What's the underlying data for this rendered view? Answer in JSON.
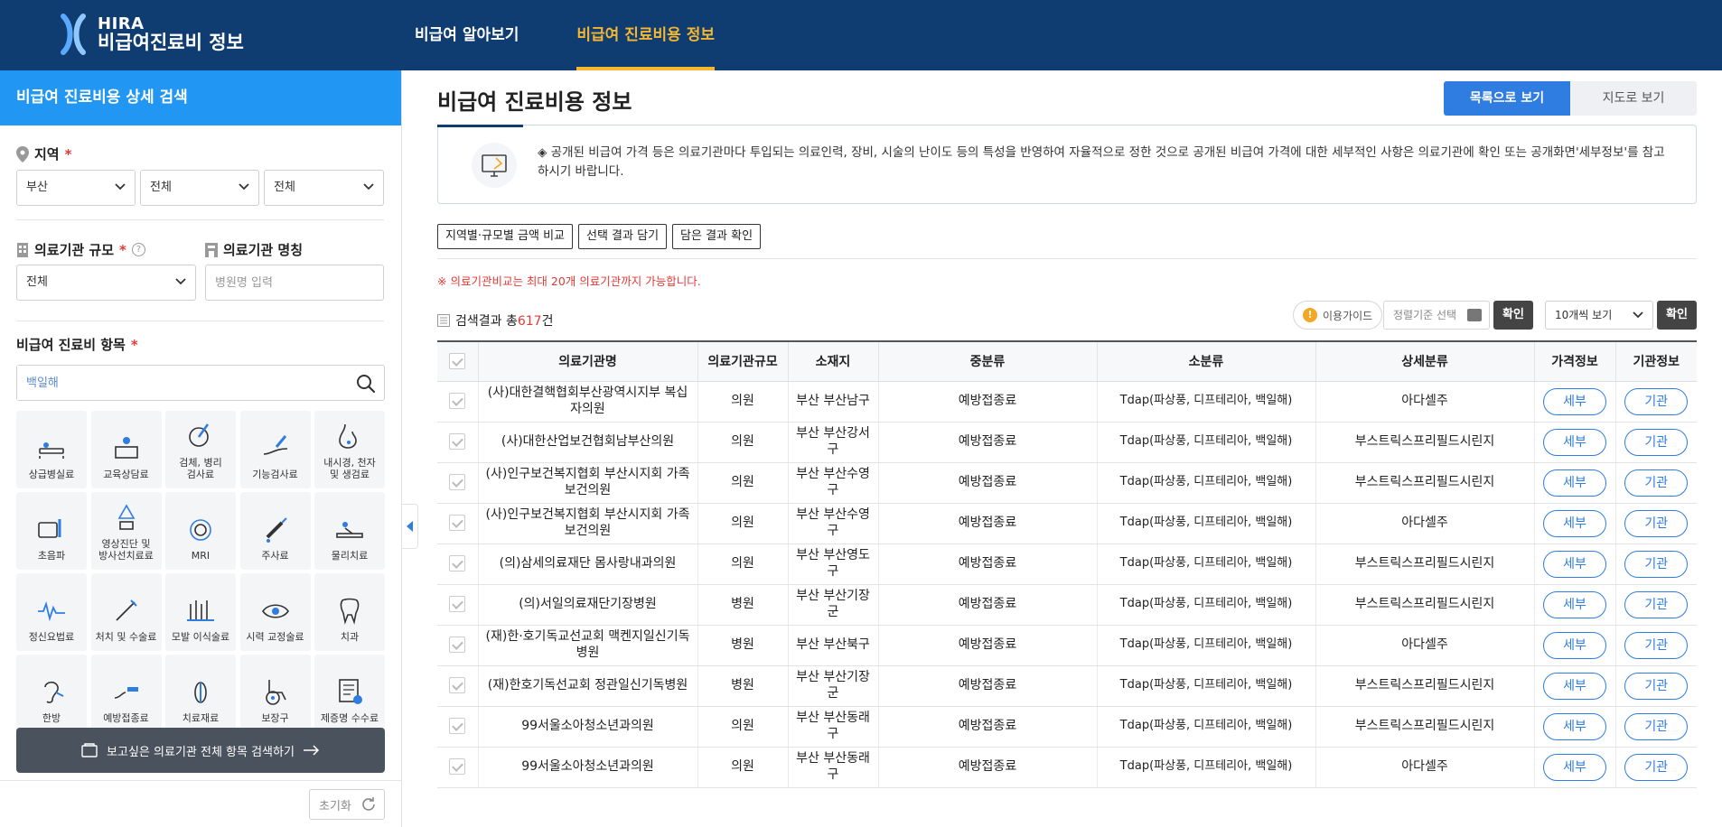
{
  "header": {
    "logo_line1": "HIRA",
    "logo_line2": "비급여진료비 정보",
    "nav": [
      "비급여 알아보기",
      "비급여 진료비용 정보"
    ]
  },
  "sidebar": {
    "title": "비급여 진료비용 상세 검색",
    "region": {
      "label": "지역",
      "required": "*",
      "select1": "부산",
      "select2": "전체",
      "select3": "전체"
    },
    "size": {
      "label": "의료기관 규모",
      "required": "*",
      "help": "?",
      "value": "전체"
    },
    "name": {
      "label": "의료기관 명칭",
      "placeholder": "병원명 입력"
    },
    "items": {
      "label": "비급여 진료비 항목",
      "required": "*",
      "search_placeholder": "백일해",
      "tiles": [
        "상급병실료",
        "교육상담료",
        "검체, 병리\n검사료",
        "기능검사료",
        "내시경, 천자\n및 생검료",
        "초음파",
        "영상진단 및\n방사선치료료",
        "MRI",
        "주사료",
        "물리치료",
        "정신요법료",
        "처치 및 수술료",
        "모발 이식술료",
        "시력 교정술료",
        "치과",
        "한방",
        "예방접종료",
        "치료재료",
        "보장구",
        "제증명 수수료"
      ]
    },
    "search_all_button": "보고싶은 의료기관 전체 항목 검색하기",
    "reset_button": "초기화"
  },
  "main": {
    "title": "비급여 진료비용 정보",
    "view_list": "목록으로 보기",
    "view_map": "지도로 보기",
    "notice": "◈ 공개된 비급여 가격 등은 의료기관마다 투입되는 의료인력, 장비, 시술의 난이도 등의 특성을 반영하여 자율적으로 정한 것으로 공개된 비급여 가격에 대한 세부적인 사항은 의료기관에 확인 또는 공개화면'세부정보'를 참고하시기 바랍니다.",
    "actions": [
      "지역별·규모별 금액 비교",
      "선택 결과 담기",
      "담은 결과 확인"
    ],
    "warning": "※ 의료기관비교는 최대 20개 의료기관까지 가능합니다.",
    "result_prefix": "검색결과 총",
    "result_count": "617",
    "result_suffix": "건",
    "guide": "이용가이드",
    "guide_dot": "!",
    "sort_placeholder": "정렬기준 선택",
    "confirm": "확인",
    "per_page": "10개씩 보기",
    "columns": [
      "의료기관명",
      "의료기관규모",
      "소재지",
      "중분류",
      "소분류",
      "상세분류",
      "가격정보",
      "기관정보"
    ],
    "detail_btn": "세부",
    "inst_btn": "기관",
    "rows": [
      {
        "name": "(사)대한결핵협회부산광역시지부 복십자의원",
        "size": "의원",
        "loc": "부산 부산남구",
        "mid": "예방접종료",
        "small": "Tdap(파상풍, 디프테리아, 백일해)",
        "detail": "아다셀주"
      },
      {
        "name": "(사)대한산업보건협회남부산의원",
        "size": "의원",
        "loc": "부산 부산강서구",
        "mid": "예방접종료",
        "small": "Tdap(파상풍, 디프테리아, 백일해)",
        "detail": "부스트릭스프리필드시린지"
      },
      {
        "name": "(사)인구보건복지협회 부산시지회 가족보건의원",
        "size": "의원",
        "loc": "부산 부산수영구",
        "mid": "예방접종료",
        "small": "Tdap(파상풍, 디프테리아, 백일해)",
        "detail": "부스트릭스프리필드시린지"
      },
      {
        "name": "(사)인구보건복지협회 부산시지회 가족보건의원",
        "size": "의원",
        "loc": "부산 부산수영구",
        "mid": "예방접종료",
        "small": "Tdap(파상풍, 디프테리아, 백일해)",
        "detail": "아다셀주"
      },
      {
        "name": "(의)삼세의료재단 몸사랑내과의원",
        "size": "의원",
        "loc": "부산 부산영도구",
        "mid": "예방접종료",
        "small": "Tdap(파상풍, 디프테리아, 백일해)",
        "detail": "부스트릭스프리필드시린지"
      },
      {
        "name": "(의)서일의료재단기장병원",
        "size": "병원",
        "loc": "부산 부산기장군",
        "mid": "예방접종료",
        "small": "Tdap(파상풍, 디프테리아, 백일해)",
        "detail": "부스트릭스프리필드시린지"
      },
      {
        "name": "(재)한·호기독교선교회 맥켄지일신기독병원",
        "size": "병원",
        "loc": "부산 부산북구",
        "mid": "예방접종료",
        "small": "Tdap(파상풍, 디프테리아, 백일해)",
        "detail": "아다셀주"
      },
      {
        "name": "(재)한호기독선교회 정관일신기독병원",
        "size": "병원",
        "loc": "부산 부산기장군",
        "mid": "예방접종료",
        "small": "Tdap(파상풍, 디프테리아, 백일해)",
        "detail": "부스트릭스프리필드시린지"
      },
      {
        "name": "99서울소아청소년과의원",
        "size": "의원",
        "loc": "부산 부산동래구",
        "mid": "예방접종료",
        "small": "Tdap(파상풍, 디프테리아, 백일해)",
        "detail": "부스트릭스프리필드시린지"
      },
      {
        "name": "99서울소아청소년과의원",
        "size": "의원",
        "loc": "부산 부산동래구",
        "mid": "예방접종료",
        "small": "Tdap(파상풍, 디프테리아, 백일해)",
        "detail": "아다셀주"
      }
    ]
  },
  "colors": {
    "header_bg": "#0f3d72",
    "accent": "#f5b630",
    "sidebar_head": "#2196f3",
    "primary": "#2f7de1",
    "danger": "#e53935"
  },
  "icons": [
    "location-pin-icon",
    "building-icon",
    "help-icon",
    "search-icon",
    "chevron-down-icon",
    "refresh-icon",
    "document-icon",
    "arrow-right-icon",
    "collapse-arrow-icon"
  ]
}
